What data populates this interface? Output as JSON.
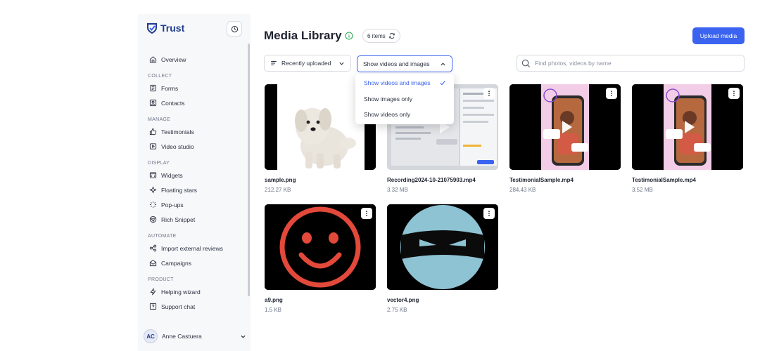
{
  "sidebar": {
    "brand": "Trust",
    "items": {
      "overview": "Overview",
      "collect_header": "COLLECT",
      "forms": "Forms",
      "contacts": "Contacts",
      "manage_header": "MANAGE",
      "testimonials": "Testimonials",
      "video_studio": "Video studio",
      "display_header": "DISPLAY",
      "widgets": "Widgets",
      "floating_stars": "Floating stars",
      "popups": "Pop-ups",
      "rich_snippet": "Rich Snippet",
      "automate_header": "AUTOMATE",
      "import_reviews": "Import external reviews",
      "campaigns": "Campaigns",
      "product_header": "PRODUCT",
      "helping_wizard": "Helping wizard",
      "support_chat": "Support chat"
    },
    "user": {
      "initials": "AC",
      "name": "Anne Castuera"
    }
  },
  "header": {
    "title": "Media Library",
    "count": "6 items",
    "upload_label": "Upload media"
  },
  "filters": {
    "sort_label": "Recently uploaded",
    "type_label": "Show videos and images",
    "search_placeholder": "Find photos, videos by name"
  },
  "type_menu": {
    "options": [
      "Show videos and images",
      "Show images only",
      "Show videos only"
    ],
    "selected": "Show videos and images"
  },
  "media": [
    {
      "name": "sample.png",
      "size": "212.27 KB",
      "kind": "image"
    },
    {
      "name": "Recording2024-10-21075903.mp4",
      "size": "3.32 MB",
      "kind": "video"
    },
    {
      "name": "TestimonialSample.mp4",
      "size": "284.43 KB",
      "kind": "video"
    },
    {
      "name": "TestimonialSample.mp4",
      "size": "3.52 MB",
      "kind": "video"
    },
    {
      "name": "a9.png",
      "size": "1.5 KB",
      "kind": "image"
    },
    {
      "name": "vector4.png",
      "size": "2.75 KB",
      "kind": "image"
    }
  ],
  "colors": {
    "accent": "#3a63f0",
    "brand": "#1f3b8f",
    "success": "#2fa84f",
    "smiley_red": "#e2493a",
    "ninja_blue": "#8ec3d3",
    "testimonial_pink": "#f3cde7"
  }
}
